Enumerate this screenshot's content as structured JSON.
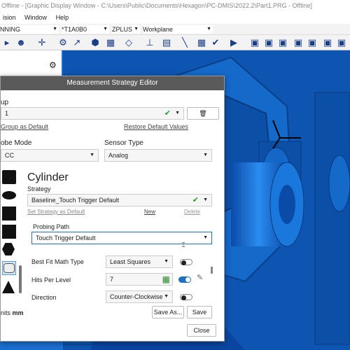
{
  "window": {
    "title": "Offline - [Graphic Display Window - C:\\Users\\Public\\Documents\\Hexagon\\PC-DMIS\\2022.2\\Part1.PRG - Offline]"
  },
  "menu": [
    "ision",
    "Window",
    "Help"
  ],
  "combos": {
    "mode": "NNING",
    "probe": "*T1A0B0",
    "plane": "ZPLUS",
    "workplane": "Workplane"
  },
  "dialog": {
    "title": "Measurement Strategy Editor",
    "group_label": "up",
    "group_value": "1",
    "set_group_default": "Group as Default",
    "restore_defaults": "Restore Default Values",
    "probe_mode_label": "obe Mode",
    "probe_mode_value": "CC",
    "sensor_type_label": "Sensor Type",
    "sensor_type_value": "Analog",
    "feature": "Cylinder",
    "strategy_label": "Strategy",
    "strategy_value": "Baseline_Touch Trigger Default",
    "set_strategy_default": "Set Strategy as Default",
    "new_link": "New",
    "delete_link": "Delete",
    "probing_path_label": "Probing Path",
    "probing_path_value": "Touch Trigger Default",
    "best_fit_label": "Best Fit Math Type",
    "best_fit_value": "Least Squares",
    "hits_label": "Hits Per Level",
    "hits_value": "7",
    "direction_label": "Direction",
    "direction_value": "Counter-Clockwise",
    "units_label": "nits",
    "units_value": "mm",
    "save_as": "Save As...",
    "save": "Save",
    "close": "Close"
  }
}
